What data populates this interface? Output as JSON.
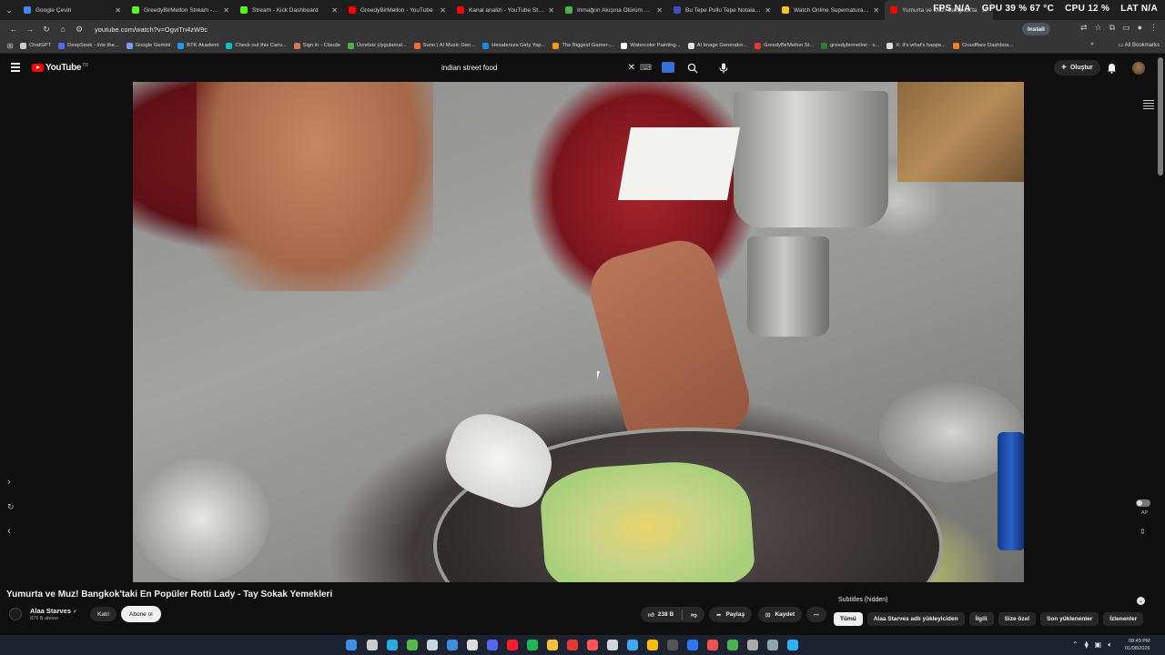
{
  "browser": {
    "tabs": [
      {
        "title": "Google Çeviri",
        "color": "#4285f4"
      },
      {
        "title": "GreedyBirMellon Stream - Watc",
        "color": "#53fc18"
      },
      {
        "title": "Stream - Kick Dashboard",
        "color": "#53fc18"
      },
      {
        "title": "GreedyBirMellon - YouTube",
        "color": "#ff0000"
      },
      {
        "title": "Kanal analizi - YouTube Studio",
        "color": "#ff0000"
      },
      {
        "title": "İnmağrın Akışına Ölürüm Türkü",
        "color": "#4caf50"
      },
      {
        "title": "Bu Tepe Pullu Tepe Notaları | N",
        "color": "#3f51b5"
      },
      {
        "title": "Watch Online Supernatural Sea",
        "color": "#f5c518"
      },
      {
        "title": "Yumurta ve Muz! Bangkok'ta",
        "color": "#ff0000",
        "active": true
      }
    ],
    "url": "youtube.com/watch?v=OgviTn4zW9c",
    "install_label": "Install",
    "sysmon": {
      "fps": "FPS N/A",
      "gpu": "GPU 39 % 67 °C",
      "cpu": "CPU 12 %",
      "lat": "LAT N/A"
    },
    "bookmarks": [
      {
        "label": "ChatGPT",
        "color": "#cfcfcf"
      },
      {
        "label": "DeepSeek - Into the...",
        "color": "#4d6bfe"
      },
      {
        "label": "Google Gemini",
        "color": "#7b9cff"
      },
      {
        "label": "BTK Akademi",
        "color": "#2196f3"
      },
      {
        "label": "Check out this Canv...",
        "color": "#00c4cc"
      },
      {
        "label": "Sign in - Claude",
        "color": "#d97757"
      },
      {
        "label": "Ücretsiz Uygulamal...",
        "color": "#4caf50"
      },
      {
        "label": "Suno | AI Music Gen...",
        "color": "#ff6b35"
      },
      {
        "label": "Hesabınıza Giriş Yap...",
        "color": "#1e88e5"
      },
      {
        "label": "The Biggest Gamer-...",
        "color": "#ff9800"
      },
      {
        "label": "Watercolor Painting...",
        "color": "#ffffff"
      },
      {
        "label": "AI Image Generator...",
        "color": "#e0e0e0"
      },
      {
        "label": "GreedyBirMellon St...",
        "color": "#e53935"
      },
      {
        "label": "greedybirmellon - s...",
        "color": "#2e7d32"
      },
      {
        "label": "X: It's what's happe...",
        "color": "#dddddd"
      },
      {
        "label": "Cloudflare Dashboa...",
        "color": "#f48120"
      }
    ],
    "all_bookmarks_label": "All Bookmarks"
  },
  "youtube": {
    "logo_text": "YouTube",
    "region": "TR",
    "search": {
      "value": "indian street food",
      "clear": "✕"
    },
    "create_label": "Oluştur",
    "video": {
      "title": "Yumurta ve Muz! Bangkok'taki En Popüler Rotti Lady - Tay Sokak Yemekleri",
      "channel": "Alaa Starves",
      "subscribers": "879 B abone",
      "join_label": "Katıl",
      "subscribe_label": "Abone ol",
      "likes": "238 B",
      "share_label": "Paylaş",
      "save_label": "Kaydet"
    },
    "subtitles_label": "Subtitles (hidden)",
    "ap_label": "AP",
    "chips": [
      {
        "label": "Tümü",
        "active": true
      },
      {
        "label": "Alaa Starves adlı yükleyiciden"
      },
      {
        "label": "İlgili"
      },
      {
        "label": "Size özel"
      },
      {
        "label": "Son yüklenenler"
      },
      {
        "label": "İzlenenler"
      }
    ]
  },
  "taskbar": {
    "time": "08:49 PM",
    "date": "01/08/2026",
    "icons": [
      {
        "name": "windows-start-icon",
        "color": "#3a8ee6"
      },
      {
        "name": "task-view-icon",
        "color": "#cccccc"
      },
      {
        "name": "edge-icon",
        "color": "#2fa8e0"
      },
      {
        "name": "xbox-icon",
        "color": "#57b947"
      },
      {
        "name": "steam-icon",
        "color": "#c7d5e0"
      },
      {
        "name": "store-icon",
        "color": "#3b8fe0"
      },
      {
        "name": "epic-icon",
        "color": "#dddddd"
      },
      {
        "name": "discord-icon",
        "color": "#5865f2"
      },
      {
        "name": "opera-icon",
        "color": "#ff1b2d"
      },
      {
        "name": "spotify-icon",
        "color": "#1db954"
      },
      {
        "name": "folder-icon",
        "color": "#f3c13a"
      },
      {
        "name": "app-red-icon",
        "color": "#e53935"
      },
      {
        "name": "app-red2-icon",
        "color": "#ff5252"
      },
      {
        "name": "notepad-icon",
        "color": "#cfd8dc"
      },
      {
        "name": "app-blue-icon",
        "color": "#42a5f5"
      },
      {
        "name": "chrome-icon",
        "color": "#fbbc05"
      },
      {
        "name": "terminal-icon",
        "color": "#555555"
      },
      {
        "name": "vscode-icon",
        "color": "#2979ff"
      },
      {
        "name": "map-pin-icon",
        "color": "#ef5350"
      },
      {
        "name": "chrome-active-icon",
        "color": "#4caf50"
      },
      {
        "name": "settings-icon",
        "color": "#aaaaaa"
      },
      {
        "name": "steam2-icon",
        "color": "#90a4ae"
      },
      {
        "name": "app-globe-icon",
        "color": "#29b6f6"
      }
    ]
  }
}
